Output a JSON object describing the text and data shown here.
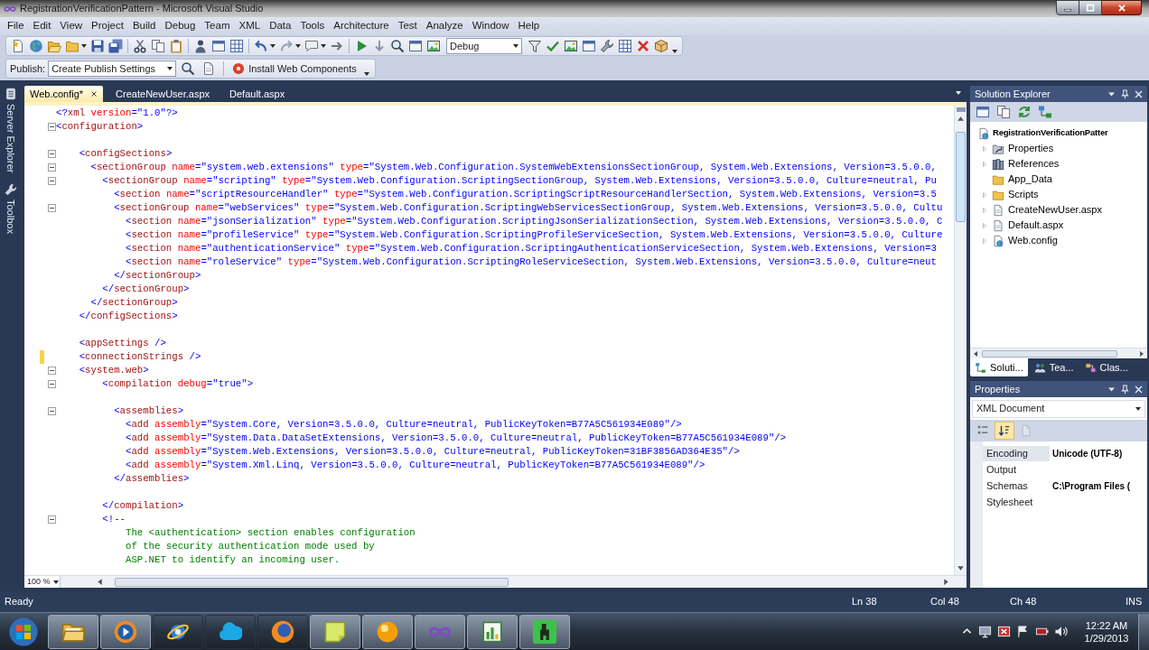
{
  "window": {
    "title": "RegistrationVerificationPattern - Microsoft Visual Studio"
  },
  "menu": [
    "File",
    "Edit",
    "View",
    "Project",
    "Build",
    "Debug",
    "Team",
    "XML",
    "Data",
    "Tools",
    "Architecture",
    "Test",
    "Analyze",
    "Window",
    "Help"
  ],
  "standard_toolbar": {
    "configuration": "Debug"
  },
  "publish_toolbar": {
    "label": "Publish:",
    "profile": "Create Publish Settings",
    "install_button": "Install Web Components"
  },
  "side_tabs": [
    "Server Explorer",
    "Toolbox"
  ],
  "document_tabs": [
    {
      "label": "Web.config*",
      "selected": true
    },
    {
      "label": "CreateNewUser.aspx",
      "selected": false
    },
    {
      "label": "Default.aspx",
      "selected": false
    }
  ],
  "editor": {
    "lines": [
      {
        "kind": "markup",
        "text": "<?xml version=\"1.0\"?>",
        "foldable": false,
        "changed": false
      },
      {
        "kind": "markup",
        "text": "<configuration>",
        "foldable": true,
        "changed": false
      },
      {
        "kind": "blank"
      },
      {
        "kind": "markup",
        "text": "    <configSections>",
        "foldable": true,
        "changed": false
      },
      {
        "kind": "markup",
        "text": "      <sectionGroup name=\"system.web.extensions\" type=\"System.Web.Configuration.SystemWebExtensionsSectionGroup, System.Web.Extensions, Version=3.5.0.0,",
        "foldable": true,
        "changed": false
      },
      {
        "kind": "markup",
        "text": "        <sectionGroup name=\"scripting\" type=\"System.Web.Configuration.ScriptingSectionGroup, System.Web.Extensions, Version=3.5.0.0, Culture=neutral, Pu",
        "foldable": true,
        "changed": false
      },
      {
        "kind": "markup",
        "text": "          <section name=\"scriptResourceHandler\" type=\"System.Web.Configuration.ScriptingScriptResourceHandlerSection, System.Web.Extensions, Version=3.5",
        "foldable": false,
        "changed": false
      },
      {
        "kind": "markup",
        "text": "          <sectionGroup name=\"webServices\" type=\"System.Web.Configuration.ScriptingWebServicesSectionGroup, System.Web.Extensions, Version=3.5.0.0, Cultu",
        "foldable": true,
        "changed": false
      },
      {
        "kind": "markup",
        "text": "            <section name=\"jsonSerialization\" type=\"System.Web.Configuration.ScriptingJsonSerializationSection, System.Web.Extensions, Version=3.5.0.0, C",
        "foldable": false,
        "changed": false
      },
      {
        "kind": "markup",
        "text": "            <section name=\"profileService\" type=\"System.Web.Configuration.ScriptingProfileServiceSection, System.Web.Extensions, Version=3.5.0.0, Culture",
        "foldable": false,
        "changed": false
      },
      {
        "kind": "markup",
        "text": "            <section name=\"authenticationService\" type=\"System.Web.Configuration.ScriptingAuthenticationServiceSection, System.Web.Extensions, Version=3",
        "foldable": false,
        "changed": false
      },
      {
        "kind": "markup",
        "text": "            <section name=\"roleService\" type=\"System.Web.Configuration.ScriptingRoleServiceSection, System.Web.Extensions, Version=3.5.0.0, Culture=neut",
        "foldable": false,
        "changed": false
      },
      {
        "kind": "markup",
        "text": "          </sectionGroup>",
        "foldable": false,
        "changed": false
      },
      {
        "kind": "markup",
        "text": "        </sectionGroup>",
        "foldable": false,
        "changed": false
      },
      {
        "kind": "markup",
        "text": "      </sectionGroup>",
        "foldable": false,
        "changed": false
      },
      {
        "kind": "markup",
        "text": "    </configSections>",
        "foldable": false,
        "changed": false
      },
      {
        "kind": "blank"
      },
      {
        "kind": "markup",
        "text": "    <appSettings />",
        "foldable": false,
        "changed": false
      },
      {
        "kind": "markup",
        "text": "    <connectionStrings />",
        "foldable": false,
        "changed": true
      },
      {
        "kind": "markup",
        "text": "    <system.web>",
        "foldable": true,
        "changed": false
      },
      {
        "kind": "markup",
        "text": "        <compilation debug=\"true\">",
        "foldable": true,
        "changed": false
      },
      {
        "kind": "blank"
      },
      {
        "kind": "markup",
        "text": "          <assemblies>",
        "foldable": true,
        "changed": false
      },
      {
        "kind": "markup",
        "text": "            <add assembly=\"System.Core, Version=3.5.0.0, Culture=neutral, PublicKeyToken=B77A5C561934E089\"/>",
        "foldable": false,
        "changed": false
      },
      {
        "kind": "markup",
        "text": "            <add assembly=\"System.Data.DataSetExtensions, Version=3.5.0.0, Culture=neutral, PublicKeyToken=B77A5C561934E089\"/>",
        "foldable": false,
        "changed": false
      },
      {
        "kind": "markup",
        "text": "            <add assembly=\"System.Web.Extensions, Version=3.5.0.0, Culture=neutral, PublicKeyToken=31BF3856AD364E35\"/>",
        "foldable": false,
        "changed": false
      },
      {
        "kind": "markup",
        "text": "            <add assembly=\"System.Xml.Linq, Version=3.5.0.0, Culture=neutral, PublicKeyToken=B77A5C561934E089\"/>",
        "foldable": false,
        "changed": false
      },
      {
        "kind": "markup",
        "text": "          </assemblies>",
        "foldable": false,
        "changed": false
      },
      {
        "kind": "blank"
      },
      {
        "kind": "markup",
        "text": "        </compilation>",
        "foldable": false,
        "changed": false
      },
      {
        "kind": "markup",
        "text": "        <!--",
        "foldable": true,
        "changed": false
      },
      {
        "kind": "comment",
        "text": "            The <authentication> section enables configuration",
        "foldable": false,
        "changed": false
      },
      {
        "kind": "comment",
        "text": "            of the security authentication mode used by",
        "foldable": false,
        "changed": false
      },
      {
        "kind": "comment",
        "text": "            ASP.NET to identify an incoming user.",
        "foldable": false,
        "changed": false
      }
    ],
    "zoom": "100 %"
  },
  "solution_explorer": {
    "title": "Solution Explorer",
    "project": {
      "label": "RegistrationVerificationPatter",
      "children": [
        {
          "label": "Properties",
          "kind": "properties",
          "expandable": true
        },
        {
          "label": "References",
          "kind": "references",
          "expandable": true
        },
        {
          "label": "App_Data",
          "kind": "folder",
          "expandable": false
        },
        {
          "label": "Scripts",
          "kind": "folder",
          "expandable": true
        },
        {
          "label": "CreateNewUser.aspx",
          "kind": "page",
          "expandable": true
        },
        {
          "label": "Default.aspx",
          "kind": "page",
          "expandable": true
        },
        {
          "label": "Web.config",
          "kind": "config",
          "expandable": true
        }
      ]
    },
    "tabs": [
      {
        "label": "Soluti...",
        "kind": "solution",
        "selected": true
      },
      {
        "label": "Tea...",
        "kind": "team",
        "selected": false
      },
      {
        "label": "Clas...",
        "kind": "class",
        "selected": false
      }
    ]
  },
  "properties": {
    "title": "Properties",
    "object": "XML Document",
    "tools": [
      {
        "kind": "categorized",
        "selected": false,
        "disabled": false
      },
      {
        "kind": "alphabetical",
        "selected": true,
        "disabled": false
      },
      {
        "kind": "pages",
        "selected": false,
        "disabled": true
      }
    ],
    "rows": [
      {
        "name": "Encoding",
        "value": "Unicode (UTF-8)",
        "selected": true
      },
      {
        "name": "Output",
        "selected": false
      },
      {
        "name": "Schemas",
        "value": "C:\\Program Files (",
        "selected": false
      },
      {
        "name": "Stylesheet",
        "selected": false
      }
    ]
  },
  "status_bar": {
    "message": "Ready",
    "line": "Ln 38",
    "column": "Col 48",
    "character": "Ch 48",
    "mode": "INS"
  },
  "taskbar": {
    "apps": [
      {
        "kind": "files",
        "running": true
      },
      {
        "kind": "media",
        "running": true
      },
      {
        "kind": "browser",
        "running": false
      },
      {
        "kind": "chat",
        "running": false
      },
      {
        "kind": "web",
        "running": false
      },
      {
        "kind": "notes",
        "running": true
      },
      {
        "kind": "ball",
        "running": true
      },
      {
        "kind": "studio",
        "running": true
      },
      {
        "kind": "chart",
        "running": true
      },
      {
        "kind": "recorder",
        "running": true
      }
    ],
    "time": "12:22 AM",
    "date": "1/29/2013"
  }
}
